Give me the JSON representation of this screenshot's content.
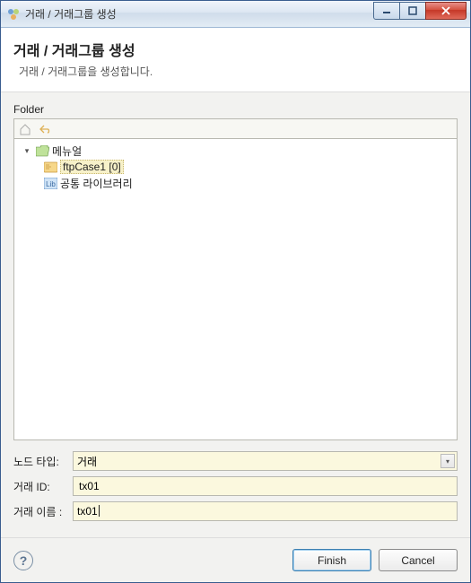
{
  "titlebar": {
    "title": "거래 / 거래그룹 생성"
  },
  "header": {
    "title": "거래 / 거래그룹 생성",
    "subtitle": "거래 / 거래그룹을 생성합니다."
  },
  "folder_section": {
    "label": "Folder",
    "tree": {
      "root": {
        "label": "메뉴얼",
        "expanded": true
      },
      "children": [
        {
          "label": "ftpCase1 [0]",
          "selected": true,
          "icon": "case"
        },
        {
          "label": "공통 라이브러리",
          "selected": false,
          "icon": "lib"
        }
      ]
    }
  },
  "form": {
    "node_type": {
      "label": "노드 타입:",
      "value": "거래"
    },
    "tx_id": {
      "label": "거래 ID:",
      "value": "tx01"
    },
    "tx_name": {
      "label": "거래 이름  :",
      "value": "tx01"
    }
  },
  "footer": {
    "finish": "Finish",
    "cancel": "Cancel"
  }
}
